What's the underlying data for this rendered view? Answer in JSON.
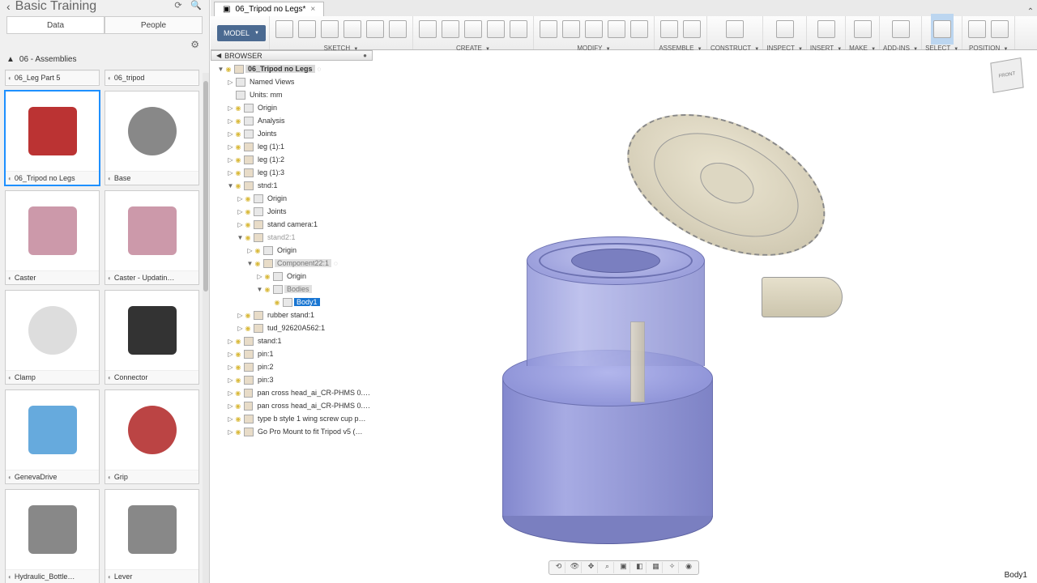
{
  "data_panel": {
    "title": "Basic Training",
    "tabs": [
      "Data",
      "People"
    ],
    "active_tab": 0,
    "breadcrumb": "06 - Assemblies",
    "thumbs": [
      {
        "label": "06_Leg Part 5",
        "half": true
      },
      {
        "label": "06_tripod",
        "half": true
      },
      {
        "label": "06_Tripod no Legs",
        "selected": true
      },
      {
        "label": "Base"
      },
      {
        "label": "Caster"
      },
      {
        "label": "Caster - Updatin…"
      },
      {
        "label": "Clamp"
      },
      {
        "label": "Connector"
      },
      {
        "label": "GenevaDrive"
      },
      {
        "label": "Grip"
      },
      {
        "label": "Hydraulic_Bottle…"
      },
      {
        "label": "Lever"
      }
    ]
  },
  "doc_tab": {
    "title": "06_Tripod no Legs*"
  },
  "toolbar": {
    "workspace": "MODEL",
    "groups": [
      {
        "label": "SKETCH",
        "icons": [
          "undo",
          "redo",
          "line",
          "rect",
          "arc",
          "spline"
        ]
      },
      {
        "label": "CREATE",
        "icons": [
          "box",
          "grid",
          "cyl",
          "cube",
          "extr"
        ]
      },
      {
        "label": "MODIFY",
        "icons": [
          "cut",
          "push",
          "pull",
          "shell",
          "move"
        ]
      },
      {
        "label": "ASSEMBLE",
        "icons": [
          "joint",
          "asm"
        ]
      },
      {
        "label": "CONSTRUCT",
        "icons": [
          "plane"
        ]
      },
      {
        "label": "INSPECT",
        "icons": [
          "measure"
        ]
      },
      {
        "label": "INSERT",
        "icons": [
          "decal"
        ]
      },
      {
        "label": "MAKE",
        "icons": [
          "3dp"
        ]
      },
      {
        "label": "ADD-INS",
        "icons": [
          "addin"
        ]
      },
      {
        "label": "SELECT",
        "icons": [
          "select"
        ],
        "active": true
      },
      {
        "label": "POSITION",
        "icons": [
          "pos1",
          "pos2"
        ]
      }
    ]
  },
  "browser": {
    "title": "BROWSER",
    "tree": [
      {
        "ind": 0,
        "exp": "▼",
        "bulb": true,
        "icon": "comp",
        "label": "06_Tripod no Legs",
        "root": true,
        "spin": true
      },
      {
        "ind": 1,
        "exp": "▷",
        "icon": "fold",
        "label": "Named Views"
      },
      {
        "ind": 1,
        "exp": "",
        "icon": "fold",
        "label": "Units: mm"
      },
      {
        "ind": 1,
        "exp": "▷",
        "bulb": true,
        "icon": "fold",
        "label": "Origin"
      },
      {
        "ind": 1,
        "exp": "▷",
        "bulb": true,
        "icon": "fold",
        "label": "Analysis"
      },
      {
        "ind": 1,
        "exp": "▷",
        "bulb": true,
        "icon": "fold",
        "label": "Joints"
      },
      {
        "ind": 1,
        "exp": "▷",
        "bulb": true,
        "icon": "comp",
        "label": "leg (1):1"
      },
      {
        "ind": 1,
        "exp": "▷",
        "bulb": true,
        "icon": "comp",
        "label": "leg (1):2"
      },
      {
        "ind": 1,
        "exp": "▷",
        "bulb": true,
        "icon": "comp",
        "label": "leg (1):3"
      },
      {
        "ind": 1,
        "exp": "▼",
        "bulb": true,
        "icon": "comp",
        "label": "stnd:1"
      },
      {
        "ind": 2,
        "exp": "▷",
        "bulb": true,
        "icon": "fold",
        "label": "Origin"
      },
      {
        "ind": 2,
        "exp": "▷",
        "bulb": true,
        "icon": "fold",
        "label": "Joints"
      },
      {
        "ind": 2,
        "exp": "▷",
        "bulb": true,
        "icon": "comp",
        "label": "stand camera:1"
      },
      {
        "ind": 2,
        "exp": "▼",
        "bulb": true,
        "icon": "comp",
        "label": "stand2:1",
        "dim": true
      },
      {
        "ind": 3,
        "exp": "▷",
        "bulb": true,
        "icon": "fold",
        "label": "Origin"
      },
      {
        "ind": 3,
        "exp": "▼",
        "bulb": true,
        "icon": "comp",
        "label": "Component22:1",
        "selgrey": true,
        "spin": true
      },
      {
        "ind": 4,
        "exp": "▷",
        "bulb": true,
        "icon": "fold",
        "label": "Origin"
      },
      {
        "ind": 4,
        "exp": "▼",
        "bulb": true,
        "icon": "fold",
        "label": "Bodies",
        "selgrey": true
      },
      {
        "ind": 5,
        "exp": "",
        "bulb": true,
        "icon": "body",
        "label": "Body1",
        "selblue": true
      },
      {
        "ind": 2,
        "exp": "▷",
        "bulb": true,
        "icon": "comp",
        "label": "rubber stand:1"
      },
      {
        "ind": 2,
        "exp": "▷",
        "bulb": true,
        "icon": "comp",
        "label": "tud_92620A562:1"
      },
      {
        "ind": 1,
        "exp": "▷",
        "bulb": true,
        "icon": "comp",
        "label": "stand:1"
      },
      {
        "ind": 1,
        "exp": "▷",
        "bulb": true,
        "icon": "comp",
        "label": "pin:1"
      },
      {
        "ind": 1,
        "exp": "▷",
        "bulb": true,
        "icon": "comp",
        "label": "pin:2"
      },
      {
        "ind": 1,
        "exp": "▷",
        "bulb": true,
        "icon": "comp",
        "label": "pin:3"
      },
      {
        "ind": 1,
        "exp": "▷",
        "bulb": true,
        "icon": "comp",
        "label": "pan cross head_ai_CR-PHMS 0.…"
      },
      {
        "ind": 1,
        "exp": "▷",
        "bulb": true,
        "icon": "comp",
        "label": "pan cross head_ai_CR-PHMS 0.…"
      },
      {
        "ind": 1,
        "exp": "▷",
        "bulb": true,
        "icon": "comp",
        "label": "type b style 1 wing screw cup p…"
      },
      {
        "ind": 1,
        "exp": "▷",
        "bulb": true,
        "icon": "comp",
        "label": "Go Pro Mount to fit Tripod v5 (…"
      }
    ]
  },
  "view_cube": {
    "face": "FRONT"
  },
  "navbar_icons": [
    "orbit",
    "look",
    "pan",
    "zoom",
    "fit",
    "display",
    "grid",
    "effects",
    "camera"
  ],
  "status": "Body1"
}
